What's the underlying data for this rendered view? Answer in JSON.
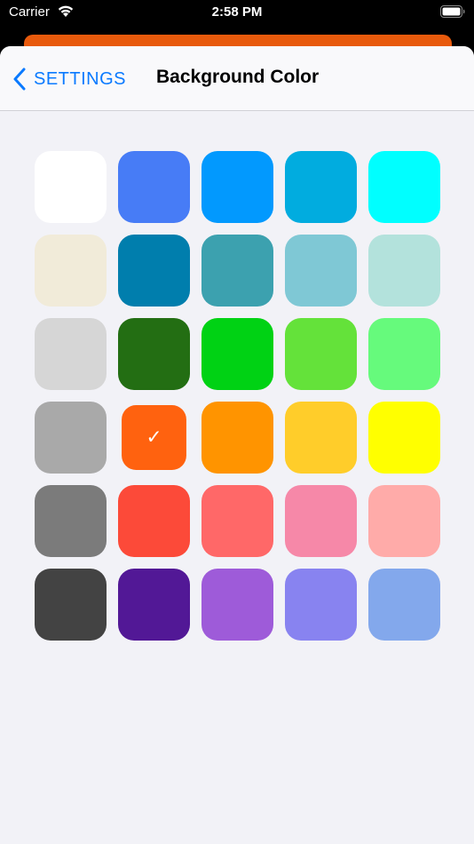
{
  "status_bar": {
    "carrier": "Carrier",
    "time": "2:58 PM"
  },
  "nav": {
    "back_label": "SETTINGS",
    "title": "Background Color"
  },
  "palette": {
    "selected_index": 16,
    "check_glyph": "✓",
    "columns": 5,
    "colors": [
      "#ffffff",
      "#477cf6",
      "#0299fe",
      "#01acdf",
      "#00ffff",
      "#f1ebd9",
      "#007ead",
      "#3ca1af",
      "#7fc8d5",
      "#b3e2dc",
      "#d6d6d6",
      "#236e13",
      "#00d214",
      "#64e23a",
      "#66fa7c",
      "#a9a9a9",
      "#ff620f",
      "#ff9400",
      "#ffcd2a",
      "#ffff00",
      "#7b7b7b",
      "#fc4a39",
      "#ff6868",
      "#f688a8",
      "#ffaba9",
      "#434343",
      "#521896",
      "#9e5bd9",
      "#8883f0",
      "#83a8ec"
    ]
  }
}
